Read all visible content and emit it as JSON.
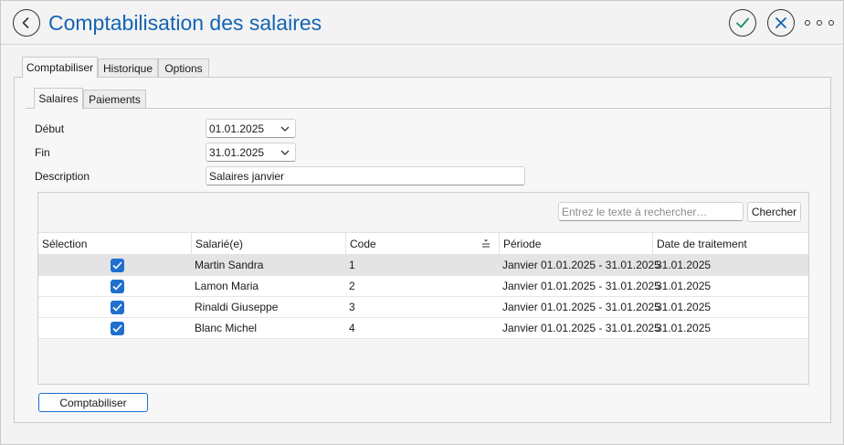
{
  "window": {
    "title": "Comptabilisation des salaires",
    "accent_color": "#1464b4",
    "icons": {
      "back": "back-arrow-icon",
      "ok": "check-icon",
      "close": "close-icon",
      "more": "more-icon"
    }
  },
  "main_tabs": [
    {
      "label": "Comptabiliser",
      "active": true
    },
    {
      "label": "Historique",
      "active": false
    },
    {
      "label": "Options",
      "active": false
    }
  ],
  "sub_tabs": [
    {
      "label": "Salaires",
      "active": true
    },
    {
      "label": "Paiements",
      "active": false
    }
  ],
  "form": {
    "start_label": "Début",
    "start_value": "01.01.2025",
    "end_label": "Fin",
    "end_value": "31.01.2025",
    "description_label": "Description",
    "description_value": "Salaires janvier"
  },
  "search": {
    "placeholder": "Entrez le texte à rechercher…",
    "button_label": "Chercher"
  },
  "table": {
    "columns": [
      "Sélection",
      "Salarié(e)",
      "Code",
      "Période",
      "Date de traitement"
    ],
    "rows": [
      {
        "selected": true,
        "employee": "Martin Sandra",
        "code": "1",
        "period": "Janvier 01.01.2025 - 31.01.2025",
        "processing_date": "31.01.2025"
      },
      {
        "selected": true,
        "employee": "Lamon Maria",
        "code": "2",
        "period": "Janvier 01.01.2025 - 31.01.2025",
        "processing_date": "31.01.2025"
      },
      {
        "selected": true,
        "employee": "Rinaldi Giuseppe",
        "code": "3",
        "period": "Janvier 01.01.2025 - 31.01.2025",
        "processing_date": "31.01.2025"
      },
      {
        "selected": true,
        "employee": "Blanc Michel",
        "code": "4",
        "period": "Janvier 01.01.2025 - 31.01.2025",
        "processing_date": "31.01.2025"
      }
    ]
  },
  "footer": {
    "post_button_label": "Comptabiliser"
  }
}
